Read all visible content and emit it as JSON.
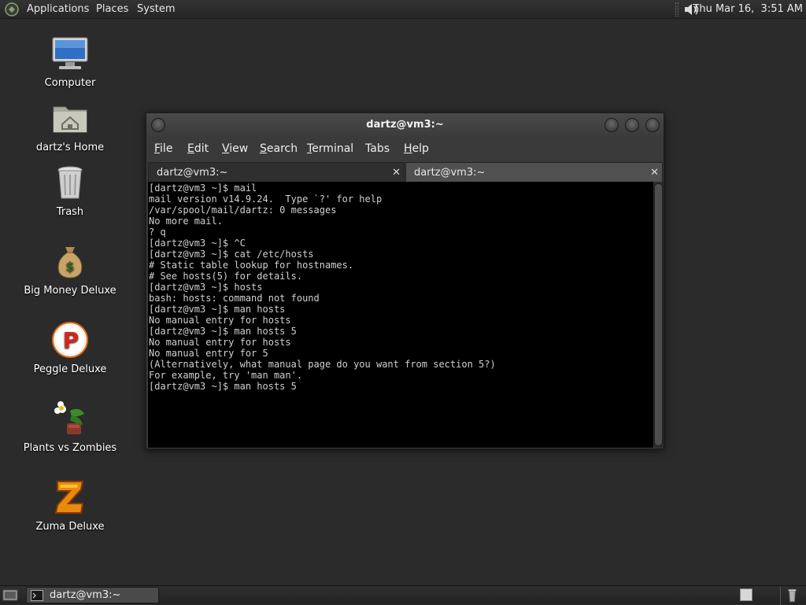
{
  "top_panel": {
    "menus": [
      "Applications",
      "Places",
      "System"
    ],
    "clock": "Thu Mar 16,  3:51 AM",
    "volume_icon": "speaker-icon",
    "logo_icon": "distro-logo-icon"
  },
  "desktop_icons": [
    {
      "label": "Computer",
      "icon": "computer-icon"
    },
    {
      "label": "dartz's Home",
      "icon": "home-folder-icon"
    },
    {
      "label": "Trash",
      "icon": "trash-icon"
    },
    {
      "label": "Big Money Deluxe",
      "icon": "money-bag-icon"
    },
    {
      "label": "Peggle Deluxe",
      "icon": "peggle-icon"
    },
    {
      "label": "Plants vs Zombies",
      "icon": "plants-vs-zombies-icon"
    },
    {
      "label": "Zuma Deluxe",
      "icon": "zuma-icon"
    }
  ],
  "terminal": {
    "title": "dartz@vm3:~",
    "menus": [
      {
        "mnemonic": "F",
        "rest": "ile"
      },
      {
        "mnemonic": "E",
        "rest": "dit"
      },
      {
        "mnemonic": "V",
        "rest": "iew"
      },
      {
        "mnemonic": "S",
        "rest": "earch"
      },
      {
        "mnemonic": "T",
        "rest": "erminal"
      },
      {
        "mnemonic": "",
        "rest": "Tabs"
      },
      {
        "mnemonic": "H",
        "rest": "elp"
      }
    ],
    "tabs": [
      {
        "label": "dartz@vm3:~",
        "active": false
      },
      {
        "label": "dartz@vm3:~",
        "active": true
      }
    ],
    "tab_close": "✕",
    "output": "[dartz@vm3 ~]$ mail\nmail version v14.9.24.  Type `?' for help\n/var/spool/mail/dartz: 0 messages\nNo more mail.\n? q\n[dartz@vm3 ~]$ ^C\n[dartz@vm3 ~]$ cat /etc/hosts\n# Static table lookup for hostnames.\n# See hosts(5) for details.\n[dartz@vm3 ~]$ hosts\nbash: hosts: command not found\n[dartz@vm3 ~]$ man hosts\nNo manual entry for hosts\n[dartz@vm3 ~]$ man hosts 5\nNo manual entry for hosts\nNo manual entry for 5\n(Alternatively, what manual page do you want from section 5?)\nFor example, try 'man man'.\n[dartz@vm3 ~]$ man hosts 5"
  },
  "bottom_panel": {
    "task_label": "dartz@vm3:~",
    "task_icon": "terminal-icon"
  },
  "colors": {
    "desktop_bg": "#2b2b2b",
    "terminal_bg": "#000000",
    "terminal_fg": "#d0d0d0"
  }
}
